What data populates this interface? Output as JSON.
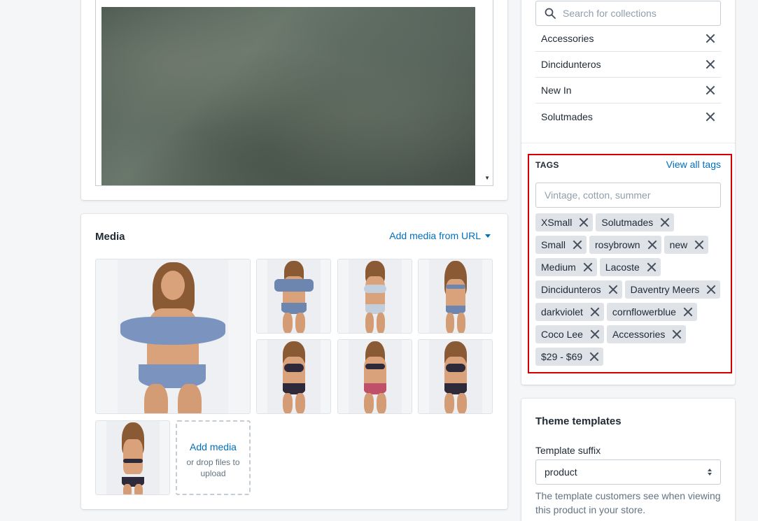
{
  "editor": {
    "image_alt": "blurred green texture image"
  },
  "media": {
    "title": "Media",
    "add_from_url": "Add media from URL",
    "add_media_link": "Add media",
    "drop_text": "or drop files to upload",
    "thumbnails": [
      {
        "name": "main",
        "top_color": "#6d86b0",
        "bottom_color": "#6d86b0"
      },
      {
        "name": "thumb-2",
        "top_color": "#6d86b0",
        "bottom_color": "#6d86b0"
      },
      {
        "name": "thumb-3",
        "top_color": "#c9d3df",
        "bottom_color": "#c9d3df"
      },
      {
        "name": "thumb-4",
        "top_color": "#6d86b0",
        "bottom_color": "#6d86b0"
      },
      {
        "name": "thumb-5",
        "top_color": "#2e2a3a",
        "bottom_color": "#2e2a3a"
      },
      {
        "name": "thumb-6",
        "top_color": "#2e2a3a",
        "bottom_color": "#2e2a3a"
      },
      {
        "name": "thumb-7",
        "top_color": "#2e2a3a",
        "bottom_color": "#2e2a3a"
      },
      {
        "name": "thumb-8",
        "top_color": "#2e2a3a",
        "bottom_color": "#2e2a3a"
      }
    ]
  },
  "collections": {
    "search_placeholder": "Search for collections",
    "items": [
      "Accessories",
      "Dincidunteros",
      "New In",
      "Solutmades"
    ]
  },
  "tags": {
    "heading": "TAGS",
    "view_all": "View all tags",
    "input_placeholder": "Vintage, cotton, summer",
    "items": [
      "XSmall",
      "Solutmades",
      "Small",
      "rosybrown",
      "new",
      "Medium",
      "Lacoste",
      "Dincidunteros",
      "Daventry Meers",
      "darkviolet",
      "cornflowerblue",
      "Coco Lee",
      "Accessories",
      "$29 - $69"
    ]
  },
  "theme": {
    "title": "Theme templates",
    "suffix_label": "Template suffix",
    "suffix_value": "product",
    "help_text": "The template customers see when viewing this product in your store."
  },
  "colors": {
    "link": "#006fbb",
    "highlight": "#d40000",
    "tag_bg": "#dfe3e8"
  }
}
